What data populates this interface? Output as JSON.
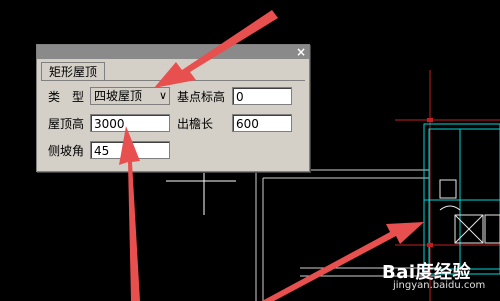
{
  "dialog": {
    "tab_label": "矩形屋顶",
    "close_icon": "×",
    "type_label": "类　型",
    "type_value": "四坡屋顶",
    "type_arrow": "∨",
    "base_elev_label": "基点标高",
    "base_elev_value": "0",
    "roof_height_label": "屋顶高",
    "roof_height_value": "3000",
    "eave_label": "出檐长",
    "eave_value": "600",
    "slope_angle_label": "侧坡角",
    "slope_angle_value": "45"
  },
  "watermark": {
    "brand": "Bai度经验",
    "url": "jingyan.baidu.com"
  },
  "colors": {
    "background": "#000000",
    "dialog": "#d4d0c8",
    "arrow": "#e8504f",
    "cad_cyan": "#00e5e5"
  }
}
